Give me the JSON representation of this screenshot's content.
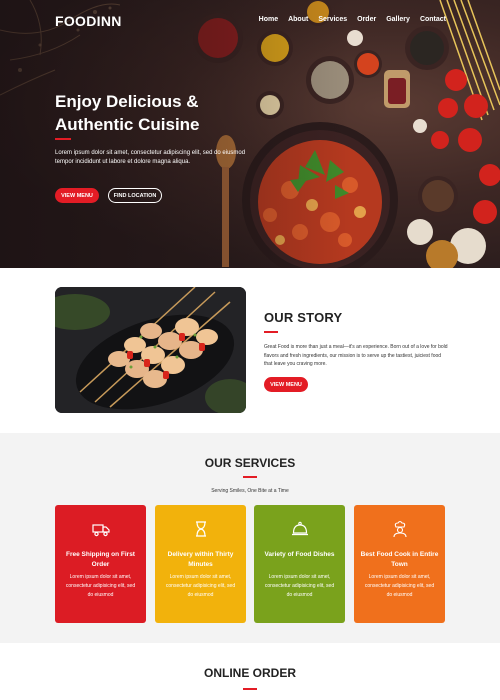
{
  "brand": "FOODINN",
  "nav": [
    "Home",
    "About",
    "Services",
    "Order",
    "Gallery",
    "Contact"
  ],
  "hero": {
    "title": "Enjoy Delicious & Authentic Cuisine",
    "text": "Lorem ipsum dolor sit amet, consectetur adipiscing elit, sed do eiusmod tempor incididunt ut labore et dolore magna aliqua.",
    "primary_button": "VIEW MENU",
    "secondary_button": "FIND LOCATION"
  },
  "story": {
    "title": "OUR STORY",
    "text": "Great Food is more than just a meal—it's an experience. Born out of a love for bold flavors and fresh ingredients, our mission is to serve up the tastiest, juiciest food that leave you craving more.",
    "button": "VIEW MENU"
  },
  "services": {
    "title": "OUR SERVICES",
    "subtitle": "Serving Smiles, One Bite at a Time",
    "cards": [
      {
        "icon": "truck-icon",
        "title": "Free Shipping on First Order",
        "text": "Lorem ipsum dolor sit amet, consectetur adipisicing elit, sed do eiusmod",
        "color": "#dc1c24"
      },
      {
        "icon": "hourglass-icon",
        "title": "Delivery within Thirty Minutes",
        "text": "Lorem ipsum dolor sit amet, consectetur adipisicing elit, sed do eiusmod",
        "color": "#f2b20c"
      },
      {
        "icon": "cloche-icon",
        "title": "Variety of Food Dishes",
        "text": "Lorem ipsum dolor sit amet, consectetur adipisicing elit, sed do eiusmod",
        "color": "#7aa21c"
      },
      {
        "icon": "chef-icon",
        "title": "Best Food Cook in Entire Town",
        "text": "Lorem ipsum dolor sit amet, consectetur adipisicing elit, sed do eiusmod",
        "color": "#f0701c"
      }
    ]
  },
  "order": {
    "title": "ONLINE ORDER"
  },
  "colors": {
    "accent": "#e31c25"
  }
}
